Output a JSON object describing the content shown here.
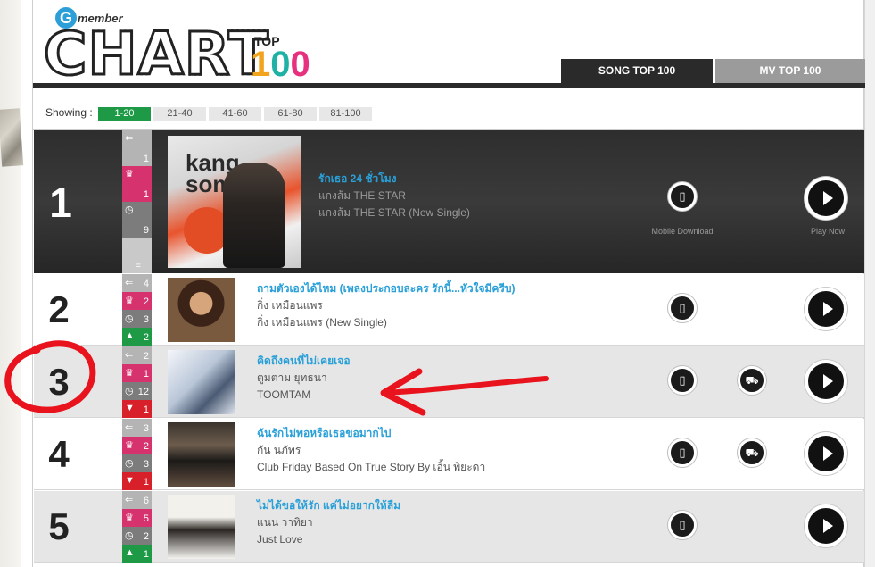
{
  "header": {
    "logo_g": "G",
    "logo_member": "member",
    "logo_chart": "CHART",
    "logo_top": "TOP",
    "logo_100_d1": "1",
    "logo_100_d2": "0",
    "logo_100_d3": "0",
    "tabs": [
      {
        "label": "SONG TOP 100",
        "active": true
      },
      {
        "label": "MV TOP 100",
        "active": false
      }
    ]
  },
  "showing": {
    "label": "Showing :",
    "pages": [
      {
        "label": "1-20",
        "active": true
      },
      {
        "label": "21-40",
        "active": false
      },
      {
        "label": "41-60",
        "active": false
      },
      {
        "label": "61-80",
        "active": false
      },
      {
        "label": "81-100",
        "active": false
      }
    ]
  },
  "captions": {
    "mobile": "Mobile Download",
    "play": "Play Now"
  },
  "icons": {
    "last_week": "arrow-left-icon",
    "peak": "crown-icon",
    "weeks": "clock-icon",
    "move_up": "arrow-up-icon",
    "move_down": "arrow-down-icon",
    "mobile": "mobile-phone-icon",
    "cart": "cart-icon",
    "play": "play-icon"
  },
  "colors": {
    "accent_title": "#2aa0d8",
    "peak_bg": "#d6336e",
    "up_bg": "#1e9a47",
    "down_bg": "#d8202a",
    "annotation": "#e8131c"
  },
  "songs": [
    {
      "rank": "1",
      "title": "รักเธอ 24 ชั่วโมง",
      "artist": "แกงส้ม THE STAR",
      "album": "แกงส้ม THE STAR (New Single)",
      "last_week": "1",
      "peak": "1",
      "weeks": "9",
      "move": "="
    },
    {
      "rank": "2",
      "title": "ถามตัวเองได้ไหม (เพลงประกอบละคร รักนี้...หัวใจมีครีบ)",
      "artist": "กิ่ง เหมือนแพร",
      "album": "กิ่ง เหมือนแพร (New Single)",
      "last_week": "4",
      "peak": "2",
      "weeks": "3",
      "move": "2"
    },
    {
      "rank": "3",
      "title": "คิดถึงคนที่ไม่เคยเจอ",
      "artist": "ตูมตาม ยุทธนา",
      "album": "TOOMTAM",
      "last_week": "2",
      "peak": "1",
      "weeks": "12",
      "move": "1"
    },
    {
      "rank": "4",
      "title": "ฉันรักไม่พอหรือเธอขอมากไป",
      "artist": "กัน นภัทร",
      "album": "Club Friday Based On True Story By เอิ้น พิยะดา",
      "last_week": "3",
      "peak": "2",
      "weeks": "3",
      "move": "1"
    },
    {
      "rank": "5",
      "title": "ไม่ได้ขอให้รัก แค่ไม่อยากให้ลืม",
      "artist": "แนน วาทิยา",
      "album": "Just Love",
      "last_week": "6",
      "peak": "5",
      "weeks": "2",
      "move": "1"
    }
  ],
  "cover_texts": {
    "row1_kang": "kang",
    "row1_som": "som"
  }
}
